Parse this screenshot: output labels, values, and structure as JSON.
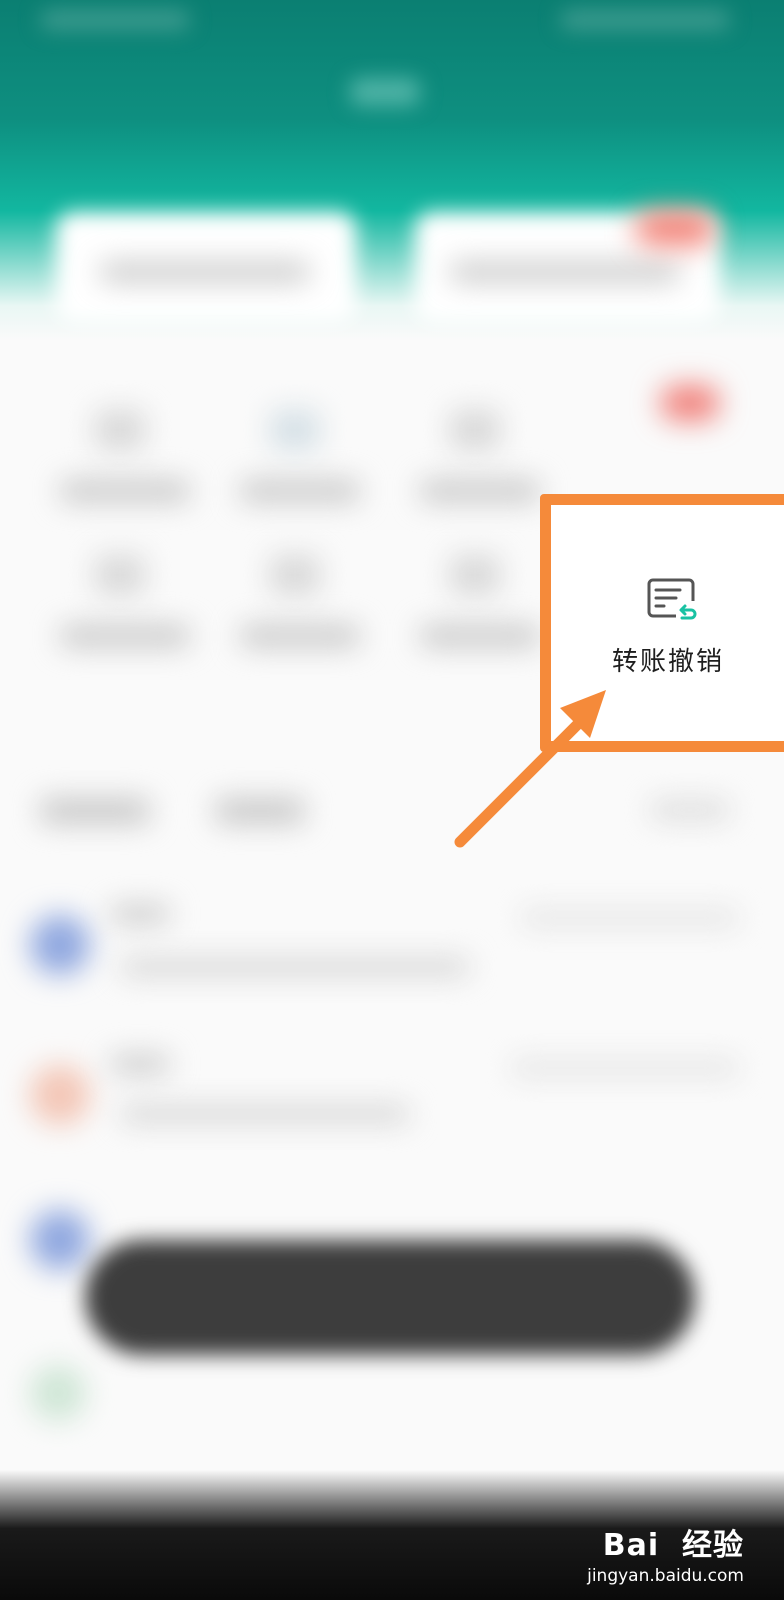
{
  "focused_shortcut": {
    "label": "转账撤销",
    "icon": "receipt-undo-icon",
    "accent_color": "#f58a3a",
    "icon_accent": "#19c2a3"
  },
  "watermark": {
    "logo_text": "Bai  经验",
    "url": "jingyan.baidu.com"
  },
  "colors": {
    "header_top": "#0b7f72",
    "header_mid": "#12b7a0",
    "annotation": "#f58a3a"
  }
}
